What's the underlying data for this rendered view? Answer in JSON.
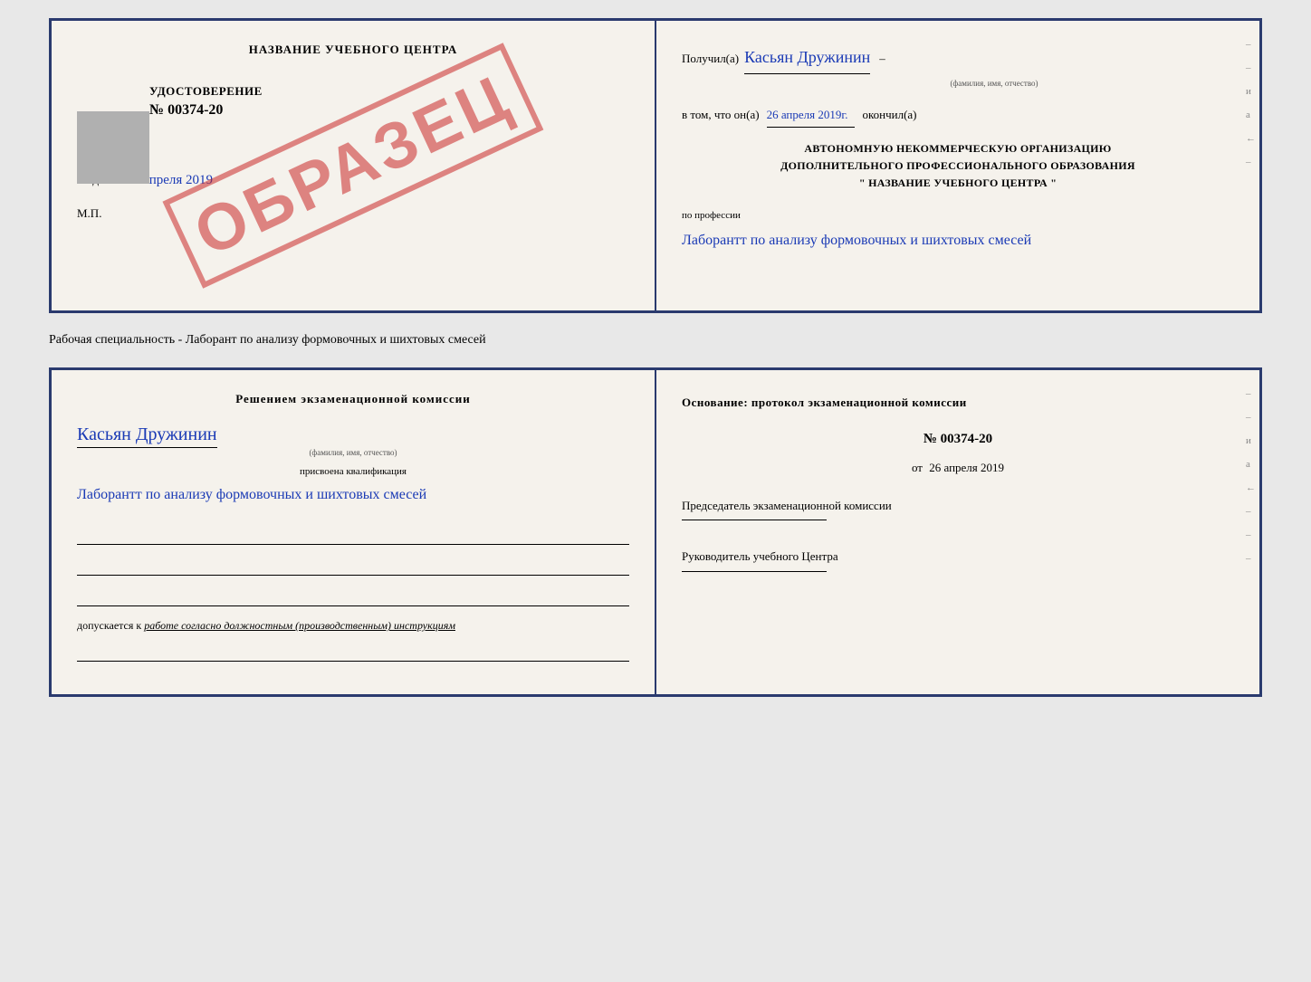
{
  "top_doc": {
    "left": {
      "title": "НАЗВАНИЕ УЧЕБНОГО ЦЕНТРА",
      "obrazec": "ОБРАЗЕЦ",
      "udostoverenie_label": "УДОСТОВЕРЕНИЕ",
      "udostoverenie_number": "№ 00374-20",
      "vydano": "Выдано",
      "vydano_date": "26 апреля 2019",
      "mp": "М.П."
    },
    "right": {
      "poluchil_label": "Получил(а)",
      "recipient_name": "Касьян Дружинин",
      "fio_subtitle": "(фамилия, имя, отчество)",
      "dash1": "–",
      "vtom_label": "в том, что он(а)",
      "completion_date": "26 апреля 2019г.",
      "okonchil_label": "окончил(а)",
      "org_line1": "АВТОНОМНУЮ НЕКОММЕРЧЕСКУЮ ОРГАНИЗАЦИЮ",
      "org_line2": "ДОПОЛНИТЕЛЬНОГО ПРОФЕССИОНАЛЬНОГО ОБРАЗОВАНИЯ",
      "org_line3": "\" НАЗВАНИЕ УЧЕБНОГО ЦЕНТРА \"",
      "po_professii": "по профессии",
      "profession_handwritten": "Лаборантт по анализу формовочных и шихтовых смесей",
      "right_chars": [
        "и",
        "а",
        "←",
        "–",
        "–",
        "–"
      ]
    }
  },
  "separator": {
    "text": "Рабочая специальность - Лаборант по анализу формовочных и шихтовых смесей"
  },
  "bottom_doc": {
    "left": {
      "resheniem_title": "Решением экзаменационной комиссии",
      "recipient_name": "Касьян Дружинин",
      "fio_subtitle": "(фамилия, имя, отчество)",
      "prisvoena_label": "присвоена квалификация",
      "qualification": "Лаборантт по анализу формовочных и шихтовых смесей",
      "dopuskaetsya": "допускается к",
      "dopusk_text": "работе согласно должностным (производственным) инструкциям"
    },
    "right": {
      "osnovanie_label": "Основание: протокол экзаменационной комиссии",
      "protocol_number": "№ 00374-20",
      "ot_label": "от",
      "ot_date": "26 апреля 2019",
      "predsedatel_label": "Председатель экзаменационной комиссии",
      "rukovoditel_label": "Руководитель учебного Центра",
      "right_chars": [
        "–",
        "–",
        "и",
        "а",
        "←",
        "–",
        "–",
        "–"
      ]
    }
  }
}
